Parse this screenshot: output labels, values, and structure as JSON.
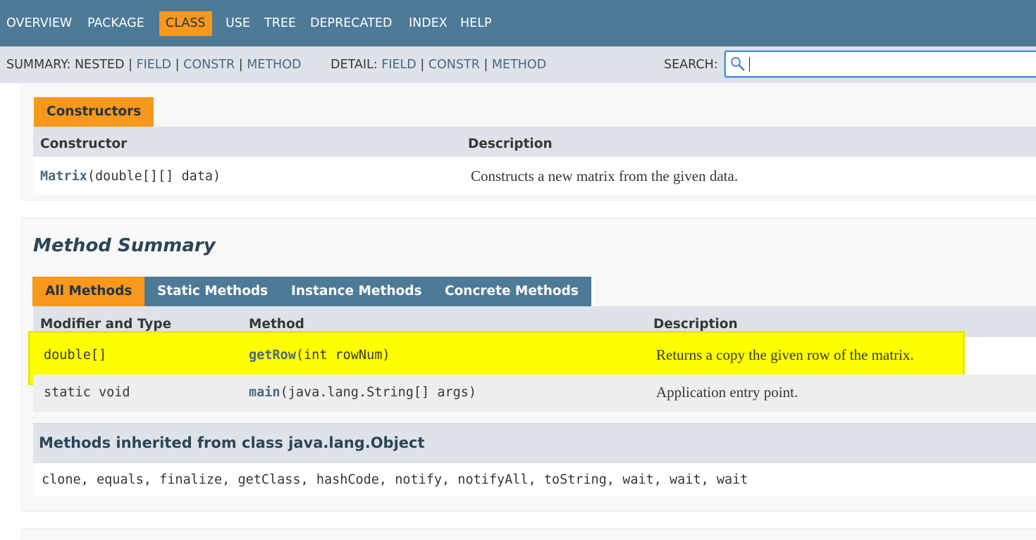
{
  "topnav": {
    "items": [
      "OVERVIEW",
      "PACKAGE",
      "CLASS",
      "USE",
      "TREE",
      "DEPRECATED",
      "INDEX",
      "HELP"
    ],
    "active": "CLASS"
  },
  "subnav": {
    "summary_label": "SUMMARY:",
    "summary_nested": "NESTED",
    "summary_field": "FIELD",
    "summary_constr": "CONSTR",
    "summary_method": "METHOD",
    "detail_label": "DETAIL:",
    "detail_field": "FIELD",
    "detail_constr": "CONSTR",
    "detail_method": "METHOD",
    "sep": "|",
    "search_label": "SEARCH:",
    "search_value": ""
  },
  "constructors": {
    "caption": "Constructors",
    "col_constructor": "Constructor",
    "col_description": "Description",
    "rows": [
      {
        "name": "Matrix",
        "params": "(double[][] data)",
        "description": "Constructs a new matrix from the given data."
      }
    ]
  },
  "method_summary": {
    "title": "Method Summary",
    "tabs": [
      "All Methods",
      "Static Methods",
      "Instance Methods",
      "Concrete Methods"
    ],
    "active_tab": "All Methods",
    "col_modifier": "Modifier and Type",
    "col_method": "Method",
    "col_description": "Description",
    "rows": [
      {
        "modifier": "double[]",
        "name": "getRow",
        "params": "(int rowNum)",
        "description": "Returns a copy the given row of the matrix.",
        "highlighted": true
      },
      {
        "modifier": "static void",
        "name": "main",
        "params": "(java.lang.String[] args)",
        "description": "Application entry point.",
        "highlighted": false
      }
    ]
  },
  "inherited": {
    "title": "Methods inherited from class java.lang.Object",
    "methods": "clone, equals, finalize, getClass, hashCode, notify, notifyAll, toString, wait, wait, wait"
  },
  "colors": {
    "nav_bg": "#4d7a97",
    "active_tab": "#f8981d",
    "subnav_bg": "#dee3e9",
    "link": "#4a6782",
    "highlight": "#ffff00"
  }
}
